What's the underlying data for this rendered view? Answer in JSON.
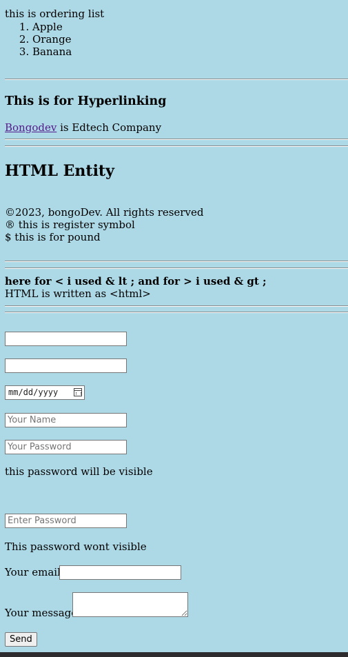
{
  "ordering": {
    "intro": "this is ordering list",
    "items": [
      "Apple",
      "Orange",
      "Banana"
    ]
  },
  "hyperlink": {
    "heading": "This is for Hyperlinking",
    "link_text": "Bongodev",
    "after_text": " is Edtech Company"
  },
  "entity": {
    "heading": "HTML Entity",
    "line1": "©2023, bongoDev. All rights reserved",
    "line2": "® this is register symbol",
    "line3": "$ this is for pound"
  },
  "lt_gt": {
    "note": "here for < i used & lt ; and for > i used & gt ;",
    "html_line": "HTML is written as <html>"
  },
  "form": {
    "date_placeholder": "mm/dd/yyyy",
    "name_placeholder": "Your Name",
    "password_placeholder": "Your Password",
    "visible_note": "this password will be visible",
    "enter_password_placeholder": "Enter Password",
    "hidden_note": "This password wont visible",
    "email_label": "Your email:",
    "message_label": "Your message:",
    "send_label": "Send"
  }
}
